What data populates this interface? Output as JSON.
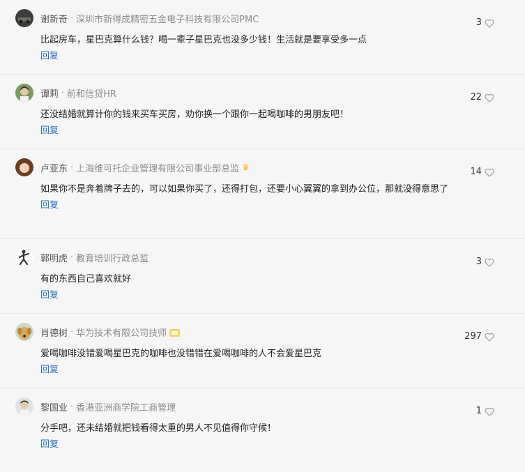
{
  "comments": [
    {
      "author": "谢新奇",
      "title": "深圳市新得成精密五金电子科技有限公司PMC",
      "badge": "",
      "likes": "3",
      "text": "比起房车，星巴克算什么钱？喝一辈子星巴克也没多少钱！生活就是要享受多一点",
      "reply": "回复",
      "avatar": "dark-car-avatar"
    },
    {
      "author": "谭莉",
      "title": "前和信贷HR",
      "badge": "",
      "likes": "22",
      "text": "还没结婚就算计你的钱来买车买房，劝你换一个跟你一起喝咖啡的男朋友吧！",
      "reply": "回复",
      "avatar": "person-avatar"
    },
    {
      "author": "卢亚东",
      "title": "上海维可托企业管理有限公司事业部总监",
      "badge": "crown",
      "likes": "14",
      "text": "如果你不是奔着牌子去的，可以如果你买了，还得打包，还要小心翼翼的拿到办公位，那就没得意思了",
      "reply": "回复",
      "avatar": "child-avatar"
    },
    {
      "author": "郭明虎",
      "title": "教育培训行政总监",
      "badge": "",
      "likes": "3",
      "text": "有的东西自己喜欢就好",
      "reply": "回复",
      "avatar": "figure-avatar"
    },
    {
      "author": "肖德树",
      "title": "华为技术有限公司技师",
      "badge": "cert",
      "likes": "297",
      "text": "爱喝咖啡没错爱喝星巴克的咖啡也没错错在爱喝咖啡的人不会爱星巴克",
      "reply": "回复",
      "avatar": "dog-avatar"
    },
    {
      "author": "黎国业",
      "title": "香港亚洲商学院工商管理",
      "badge": "",
      "likes": "1",
      "text": "分手吧，还未结婚就把钱看得太重的男人不见值得你守候！",
      "reply": "回复",
      "avatar": "man-avatar"
    }
  ],
  "separator": "·",
  "colors": {
    "link": "#2a6fbd",
    "title": "#8a8a8a",
    "crown": "#f1b221",
    "background": "#f6f6f6"
  }
}
